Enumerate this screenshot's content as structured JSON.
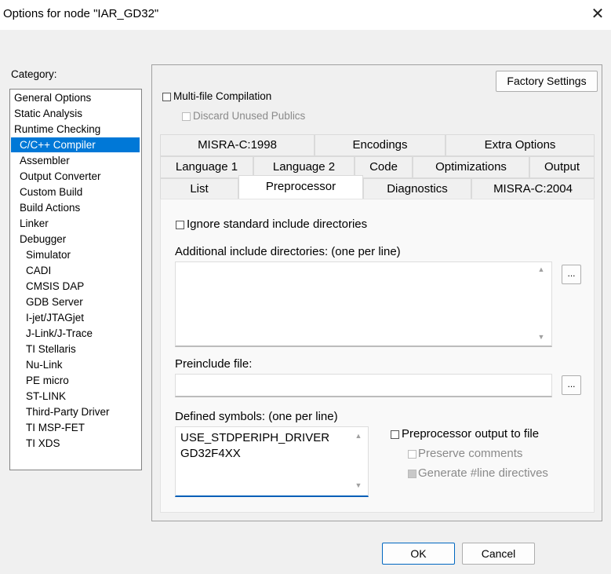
{
  "window": {
    "title": "Options for node \"IAR_GD32\"",
    "close_icon": "close-icon"
  },
  "category": {
    "label": "Category:",
    "items": [
      {
        "label": "General Options",
        "indent": 0
      },
      {
        "label": "Static Analysis",
        "indent": 0
      },
      {
        "label": "Runtime Checking",
        "indent": 0
      },
      {
        "label": "C/C++ Compiler",
        "indent": 1,
        "selected": true
      },
      {
        "label": "Assembler",
        "indent": 1
      },
      {
        "label": "Output Converter",
        "indent": 1
      },
      {
        "label": "Custom Build",
        "indent": 1
      },
      {
        "label": "Build Actions",
        "indent": 1
      },
      {
        "label": "Linker",
        "indent": 1
      },
      {
        "label": "Debugger",
        "indent": 1
      },
      {
        "label": "Simulator",
        "indent": 2
      },
      {
        "label": "CADI",
        "indent": 2
      },
      {
        "label": "CMSIS DAP",
        "indent": 2
      },
      {
        "label": "GDB Server",
        "indent": 2
      },
      {
        "label": "I-jet/JTAGjet",
        "indent": 2
      },
      {
        "label": "J-Link/J-Trace",
        "indent": 2
      },
      {
        "label": "TI Stellaris",
        "indent": 2
      },
      {
        "label": "Nu-Link",
        "indent": 2
      },
      {
        "label": "PE micro",
        "indent": 2
      },
      {
        "label": "ST-LINK",
        "indent": 2
      },
      {
        "label": "Third-Party Driver",
        "indent": 2
      },
      {
        "label": "TI MSP-FET",
        "indent": 2
      },
      {
        "label": "TI XDS",
        "indent": 2
      }
    ]
  },
  "options": {
    "factory_settings": "Factory Settings",
    "multifile": "Multi-file Compilation",
    "discard": "Discard Unused Publics"
  },
  "tabs": {
    "row1": [
      "MISRA-C:1998",
      "Encodings",
      "Extra Options"
    ],
    "row2": [
      "Language 1",
      "Language 2",
      "Code",
      "Optimizations",
      "Output"
    ],
    "row3": [
      "List",
      "Preprocessor",
      "Diagnostics",
      "MISRA-C:2004"
    ],
    "active": "Preprocessor"
  },
  "preprocessor": {
    "ignore_std": "Ignore standard include directories",
    "add_inc_label": "Additional include directories: (one per line)",
    "add_inc_value": "",
    "browse": "...",
    "preinclude_label": "Preinclude file:",
    "preinclude_value": "",
    "defined_label": "Defined symbols: (one per line)",
    "defined_lines": [
      "USE_STDPERIPH_DRIVER",
      "GD32F4XX"
    ],
    "pp_output": "Preprocessor output to file",
    "preserve": "Preserve comments",
    "gen_line": "Generate #line directives"
  },
  "buttons": {
    "ok": "OK",
    "cancel": "Cancel"
  },
  "colors": {
    "selection": "#0078d7",
    "focus_underline": "#005fb8"
  }
}
